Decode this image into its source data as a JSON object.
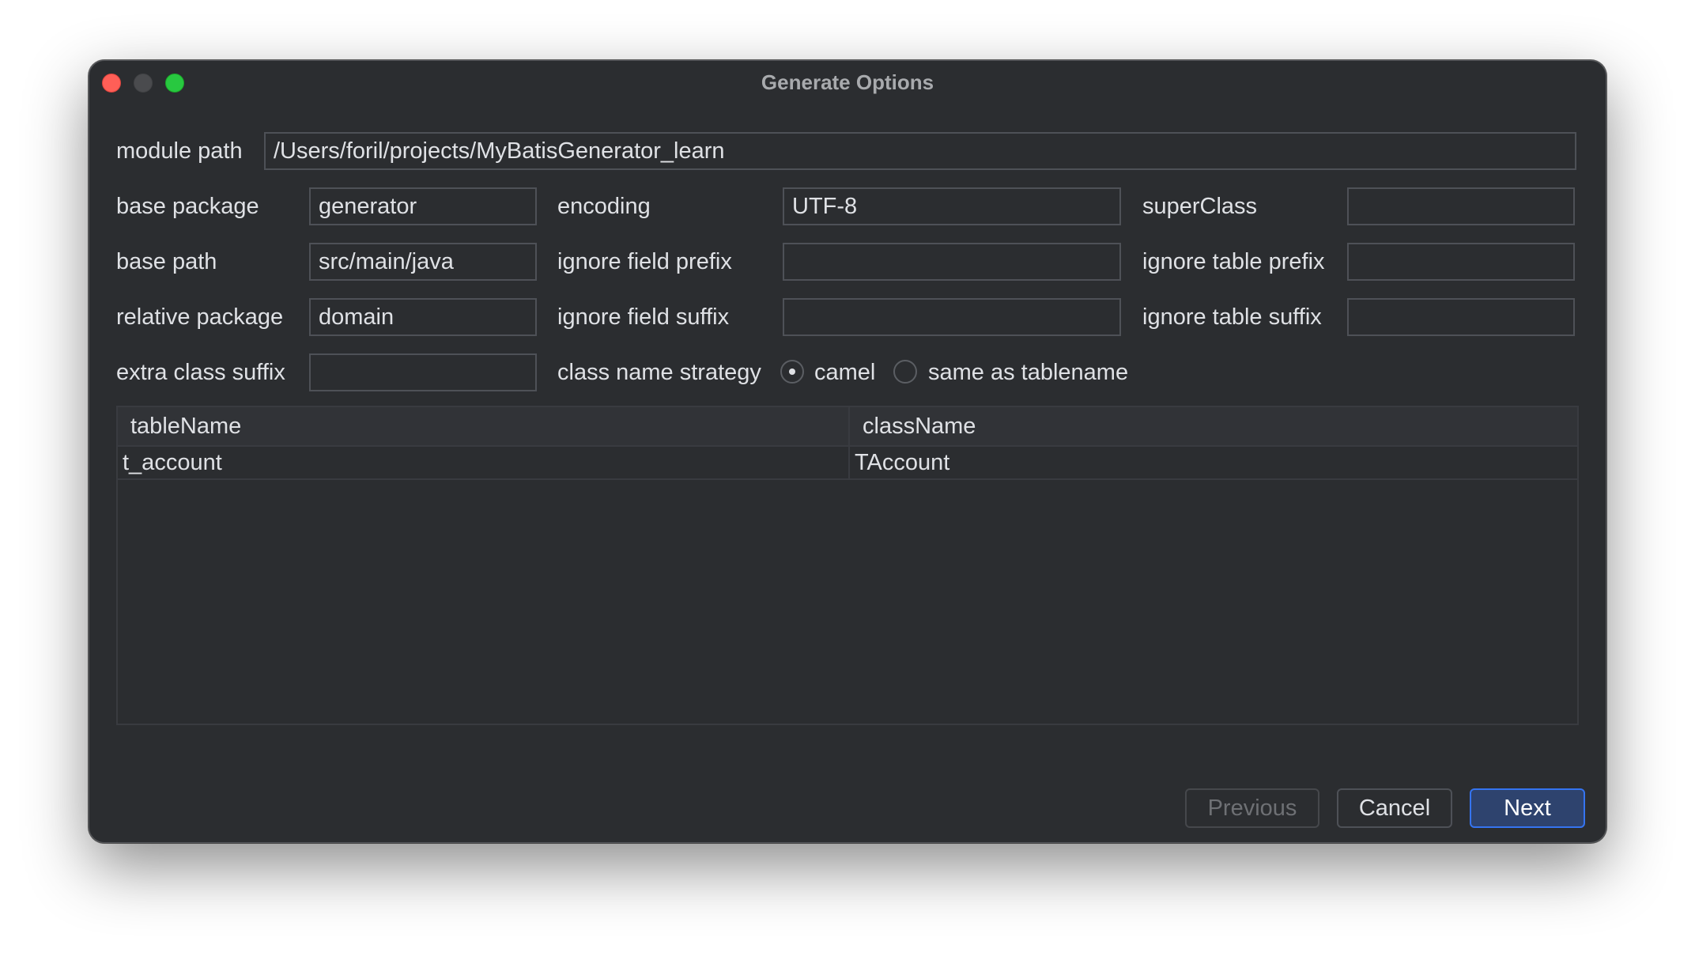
{
  "window": {
    "title": "Generate Options"
  },
  "form": {
    "module_path": {
      "label": "module path",
      "value": "/Users/foril/projects/MyBatisGenerator_learn"
    },
    "base_package": {
      "label": "base package",
      "value": "generator"
    },
    "encoding": {
      "label": "encoding",
      "value": "UTF-8"
    },
    "super_class": {
      "label": "superClass",
      "value": ""
    },
    "base_path": {
      "label": "base path",
      "value": "src/main/java"
    },
    "ignore_field_prefix": {
      "label": "ignore field prefix",
      "value": ""
    },
    "ignore_table_prefix": {
      "label": "ignore table prefix",
      "value": ""
    },
    "relative_package": {
      "label": "relative package",
      "value": "domain"
    },
    "ignore_field_suffix": {
      "label": "ignore field suffix",
      "value": ""
    },
    "ignore_table_suffix": {
      "label": "ignore table suffix",
      "value": ""
    },
    "extra_class_suffix": {
      "label": "extra class suffix",
      "value": ""
    },
    "class_name_strategy": {
      "label": "class name strategy",
      "options": [
        {
          "label": "camel",
          "selected": true
        },
        {
          "label": "same as tablename",
          "selected": false
        }
      ]
    }
  },
  "table": {
    "columns": [
      "tableName",
      "className"
    ],
    "rows": [
      [
        "t_account",
        "TAccount"
      ]
    ]
  },
  "buttons": {
    "previous": "Previous",
    "cancel": "Cancel",
    "next": "Next"
  },
  "colors": {
    "window_bg": "#2b2d30",
    "accent": "#3574f0",
    "close": "#ff5f57",
    "zoom": "#28c840"
  }
}
